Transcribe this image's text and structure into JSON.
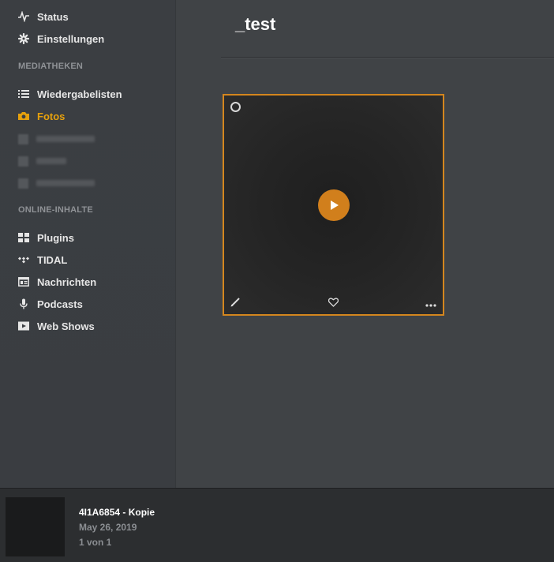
{
  "sidebar": {
    "top_items": [
      {
        "label": "Status",
        "icon": "activity-icon"
      },
      {
        "label": "Einstellungen",
        "icon": "gear-icon"
      }
    ],
    "libraries_title": "MEDIATHEKEN",
    "libraries": [
      {
        "label": "Wiedergabelisten",
        "icon": "list-icon"
      },
      {
        "label": "Fotos",
        "icon": "camera-icon",
        "active": true
      }
    ],
    "online_title": "ONLINE-INHALTE",
    "online": [
      {
        "label": "Plugins",
        "icon": "grid-icon"
      },
      {
        "label": "TIDAL",
        "icon": "tidal-icon"
      },
      {
        "label": "Nachrichten",
        "icon": "news-icon"
      },
      {
        "label": "Podcasts",
        "icon": "microphone-icon"
      },
      {
        "label": "Web Shows",
        "icon": "video-icon"
      }
    ]
  },
  "main": {
    "title": "_test"
  },
  "player": {
    "title": "4I1A6854 - Kopie",
    "date": "May 26, 2019",
    "count": "1 von 1"
  },
  "colors": {
    "accent": "#e5a00d",
    "card_border": "#d4861e",
    "play_button": "#d17f1c"
  }
}
